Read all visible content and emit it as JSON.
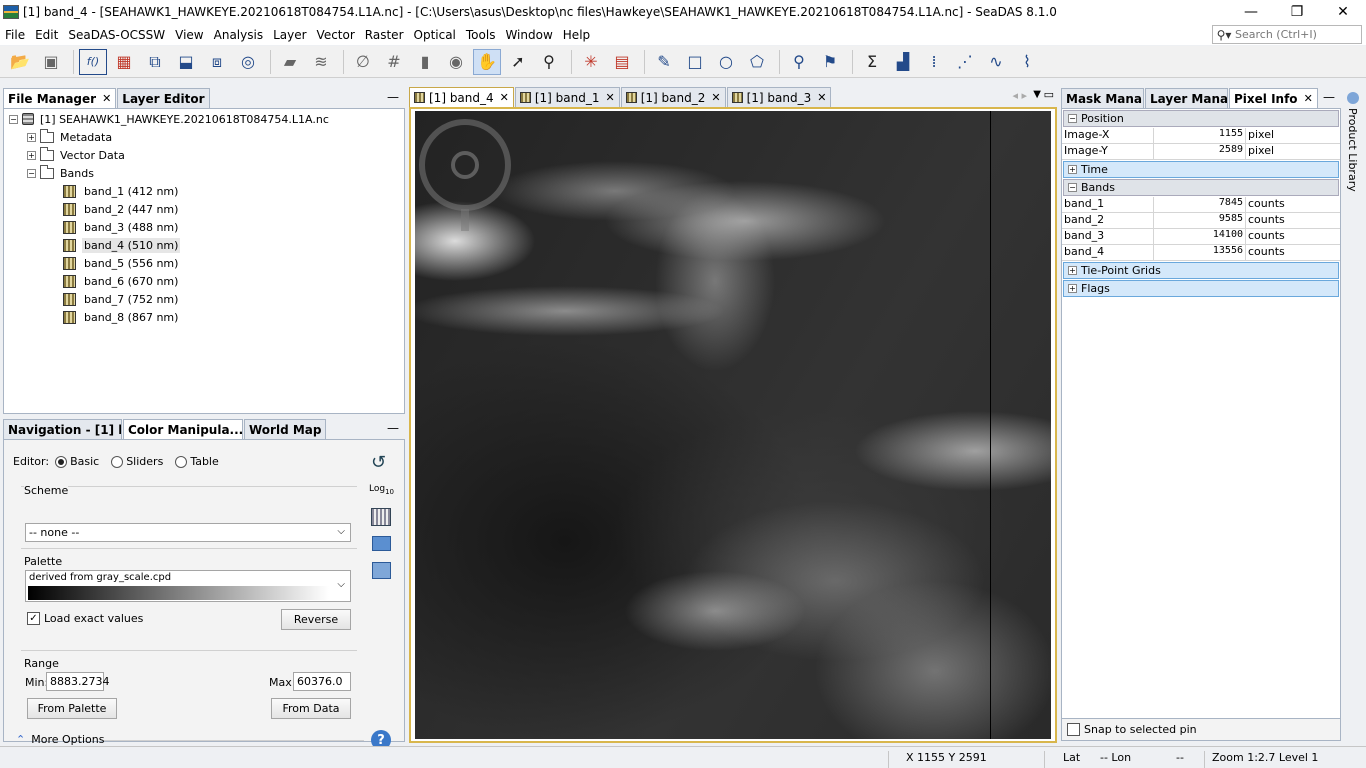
{
  "window": {
    "title": "[1] band_4 - [SEAHAWK1_HAWKEYE.20210618T084754.L1A.nc] - [C:\\Users\\asus\\Desktop\\nc files\\Hawkeye\\SEAHAWK1_HAWKEYE.20210618T084754.L1A.nc] - SeaDAS 8.1.0",
    "controls": {
      "minimize": "—",
      "restore": "❐",
      "close": "✕"
    }
  },
  "menu": [
    "File",
    "Edit",
    "SeaDAS-OCSSW",
    "View",
    "Analysis",
    "Layer",
    "Vector",
    "Raster",
    "Optical",
    "Tools",
    "Window",
    "Help"
  ],
  "search": {
    "placeholder": "Search (Ctrl+I)",
    "icon": "search-icon"
  },
  "file_manager": {
    "tabs": [
      {
        "label": "File Manager",
        "close": "✕"
      },
      {
        "label": "Layer Editor"
      }
    ],
    "minimize": "—",
    "product": "[1] SEAHAWK1_HAWKEYE.20210618T084754.L1A.nc",
    "nodes": [
      "Metadata",
      "Vector Data",
      "Bands"
    ],
    "bands": [
      "band_1 (412 nm)",
      "band_2 (447 nm)",
      "band_3 (488 nm)",
      "band_4 (510 nm)",
      "band_5 (556 nm)",
      "band_6 (670 nm)",
      "band_7 (752 nm)",
      "band_8 (867 nm)"
    ],
    "selected_band": "band_4 (510 nm)"
  },
  "lower_panel": {
    "tabs": [
      {
        "label": "Navigation - [1] ba..."
      },
      {
        "label": "Color Manipula...",
        "close": "✕"
      },
      {
        "label": "World Map"
      }
    ],
    "minimize": "—",
    "editor_label": "Editor:",
    "editor_modes": [
      "Basic",
      "Sliders",
      "Table"
    ],
    "editor_selected": "Basic",
    "scheme_label": "Scheme",
    "scheme_value": "-- none --",
    "palette_label": "Palette",
    "palette_value": "derived from gray_scale.cpd",
    "load_exact_label": "Load exact values",
    "load_exact_checked": true,
    "reverse_label": "Reverse",
    "range_label": "Range",
    "min_label": "Min:",
    "min_value": "8883.2734",
    "max_label": "Max:",
    "max_value": "60376.0",
    "from_palette_label": "From Palette",
    "from_data_label": "From Data",
    "more_options_label": "More Options",
    "log_label": "Log",
    "log_sub": "10",
    "help_icon": "?"
  },
  "image_tabs": [
    {
      "label": "[1] band_4",
      "close": "✕"
    },
    {
      "label": "[1] band_1",
      "close": "✕"
    },
    {
      "label": "[1] band_2",
      "close": "✕"
    },
    {
      "label": "[1] band_3",
      "close": "✕"
    }
  ],
  "right_panel": {
    "tabs": [
      {
        "label": "Mask Mana..."
      },
      {
        "label": "Layer Manag..."
      },
      {
        "label": "Pixel Info",
        "close": "✕"
      }
    ],
    "minimize": "—",
    "sections": {
      "position": "Position",
      "time": "Time",
      "bands": "Bands",
      "tie_point": "Tie-Point Grids",
      "flags": "Flags"
    },
    "position_rows": [
      {
        "name": "Image-X",
        "value": "1155",
        "unit": "pixel"
      },
      {
        "name": "Image-Y",
        "value": "2589",
        "unit": "pixel"
      }
    ],
    "band_rows": [
      {
        "name": "band_1",
        "value": "7845",
        "unit": "counts"
      },
      {
        "name": "band_2",
        "value": "9585",
        "unit": "counts"
      },
      {
        "name": "band_3",
        "value": "14100",
        "unit": "counts"
      },
      {
        "name": "band_4",
        "value": "13556",
        "unit": "counts"
      }
    ],
    "snap_label": "Snap to selected pin"
  },
  "side_tab": "Product Library",
  "status": {
    "xy": "X   1155  Y    2591",
    "lat": "Lat",
    "lon_sep": "-- Lon",
    "lon_end": "--",
    "zoom": "Zoom 1:2.7  Level 1"
  }
}
